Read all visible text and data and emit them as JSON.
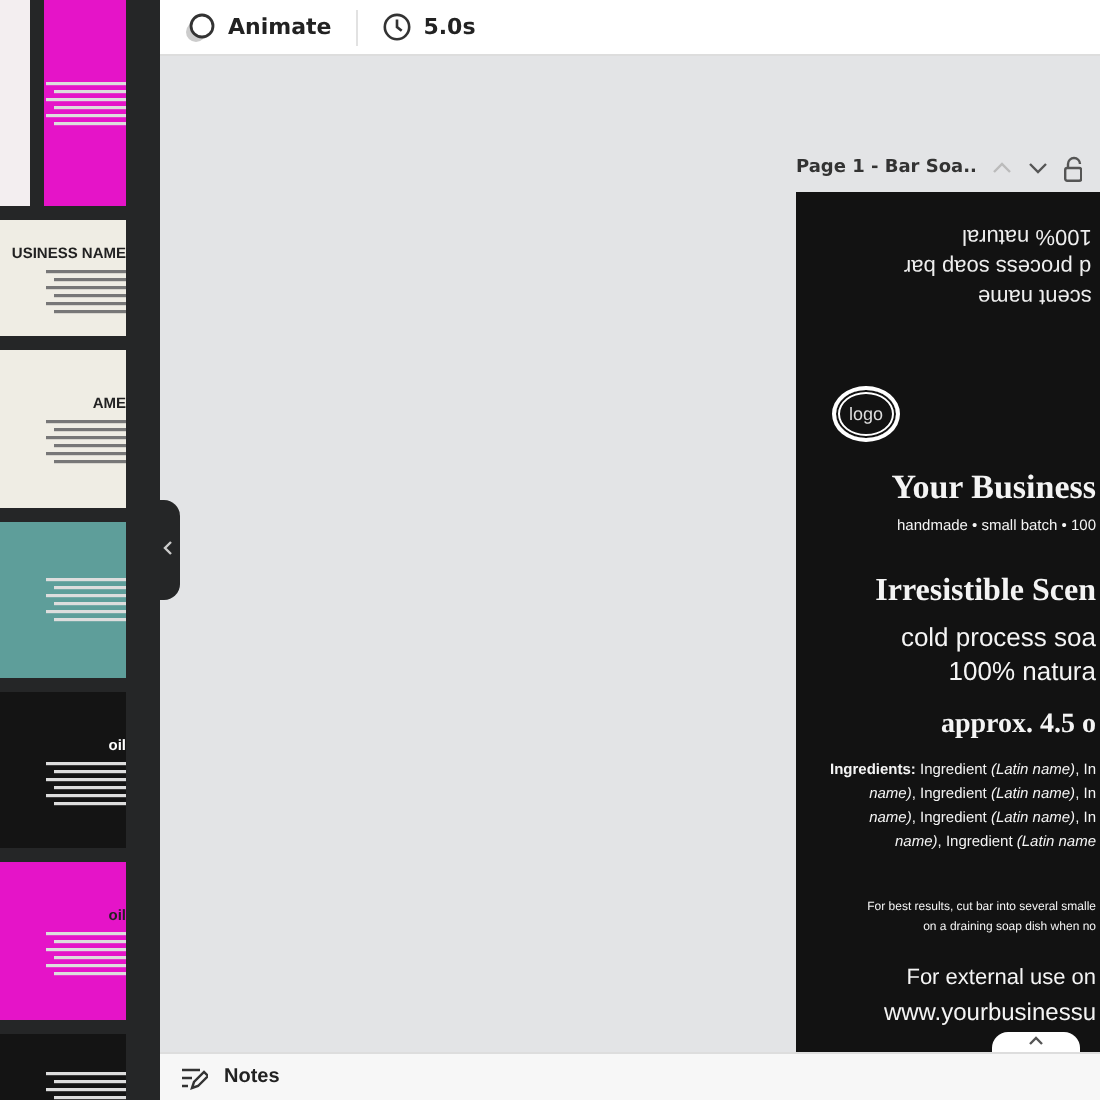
{
  "toolbar": {
    "animate": "Animate",
    "duration": "5.0s"
  },
  "sidebar": {
    "rows": [
      {
        "thumbnails": [
          {
            "color": "#f3eef0"
          },
          {
            "color": "#e514c8"
          }
        ]
      },
      {
        "thumbnails": [
          {
            "color": "#efede4",
            "title": "USINESS NAME"
          }
        ]
      },
      {
        "thumbnails": [
          {
            "color": "#efede4",
            "title": "AME"
          }
        ]
      },
      {
        "thumbnails": [
          {
            "color": "#5e9e9a"
          }
        ]
      },
      {
        "thumbnails": [
          {
            "color": "#141414",
            "title": "oil"
          }
        ]
      },
      {
        "thumbnails": [
          {
            "color": "#e514c8",
            "title": "oil"
          }
        ]
      },
      {
        "thumbnails": [
          {
            "color": "#141414"
          }
        ]
      }
    ]
  },
  "page_header": {
    "title": "Page 1 - Bar Soa..",
    "up_disabled": true
  },
  "design": {
    "upside_down": [
      "100% natural",
      "d process soap bar",
      "scent name"
    ],
    "logo": "logo",
    "business": "Your Business",
    "tagline": "handmade • small batch • 100",
    "scent": "Irresistible Scen",
    "lines": [
      "cold process soa",
      "100% natura"
    ],
    "weight": "approx. 4.5 o",
    "ingredients": [
      "**Ingredients:** Ingredient *(Latin name)*, In",
      "*name)*, Ingredient *(Latin name)*, In",
      "*name)*, Ingredient *(Latin name)*, In",
      "*name)*, Ingredient *(Latin name*"
    ],
    "tips": [
      "For best results, cut bar into several smalle",
      "on a draining soap dish when no"
    ],
    "external": "For external use on",
    "website": "www.yourbusinessu"
  },
  "notes": "Notes"
}
